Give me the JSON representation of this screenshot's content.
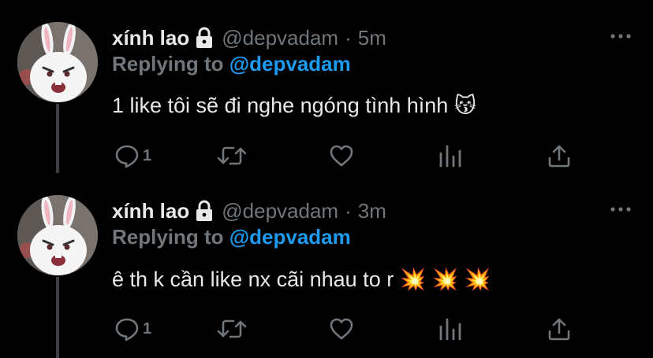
{
  "tweets": [
    {
      "display_name": "xính lao",
      "handle": "@depvadam",
      "separator": "·",
      "time": "5m",
      "replying_prefix": "Replying to",
      "replying_to": "@depvadam",
      "text": "1 like tôi sẽ đi nghe ngóng tình hình 😽",
      "reply_count": "1",
      "avatar_icon": "white-rabbit-avatar",
      "lock_icon": "lock-icon"
    },
    {
      "display_name": "xính lao",
      "handle": "@depvadam",
      "separator": "·",
      "time": "3m",
      "replying_prefix": "Replying to",
      "replying_to": "@depvadam",
      "text": "ê th k cần like nx cãi nhau to r 💥 💥 💥",
      "reply_count": "1",
      "avatar_icon": "white-rabbit-avatar",
      "lock_icon": "lock-icon"
    }
  ],
  "action_icons": [
    "reply-icon",
    "retweet-icon",
    "like-icon",
    "analytics-icon",
    "share-icon"
  ],
  "colors": {
    "background": "#000000",
    "primary_text": "#e7e9ea",
    "secondary_text": "#71767b",
    "mention": "#1d9bf0",
    "thread_line": "#3b3f43"
  }
}
